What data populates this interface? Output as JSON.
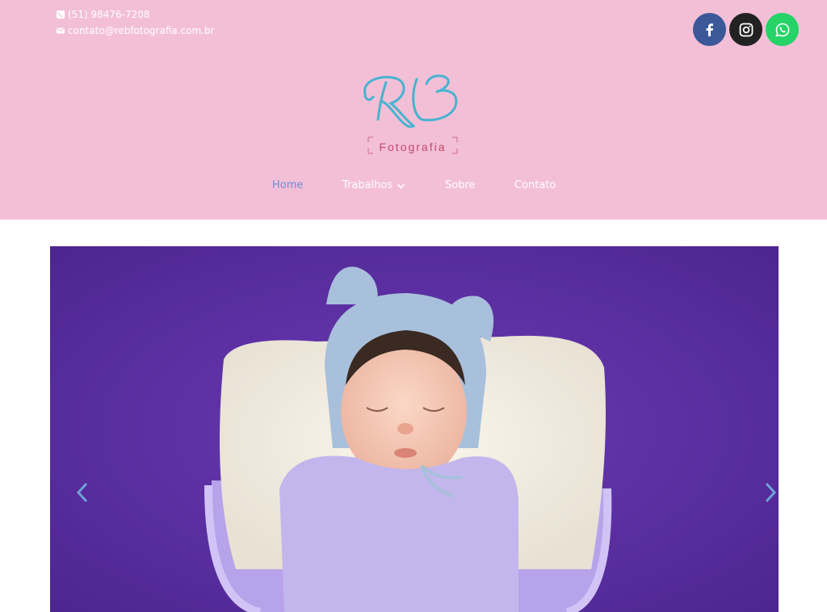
{
  "contact": {
    "phone": "(51) 98476-7208",
    "email": "contato@rebfotografia.com.br"
  },
  "social": [
    {
      "name": "facebook",
      "icon": "facebook-icon",
      "color": "#3b5998"
    },
    {
      "name": "instagram",
      "icon": "instagram-icon",
      "color": "#222222"
    },
    {
      "name": "whatsapp",
      "icon": "whatsapp-icon",
      "color": "#25d366"
    }
  ],
  "logo": {
    "initials": "RB",
    "text": "Fotografia"
  },
  "nav": {
    "items": [
      {
        "label": "Home",
        "active": true
      },
      {
        "label": "Trabalhos",
        "dropdown": true
      },
      {
        "label": "Sobre"
      },
      {
        "label": "Contato"
      }
    ]
  },
  "colors": {
    "header_bg": "#f3bfd7",
    "accent": "#6f8fd6",
    "slide_bg": "#5c2fa6"
  },
  "slider": {
    "prev_icon": "chevron-left-icon",
    "next_icon": "chevron-right-icon"
  }
}
